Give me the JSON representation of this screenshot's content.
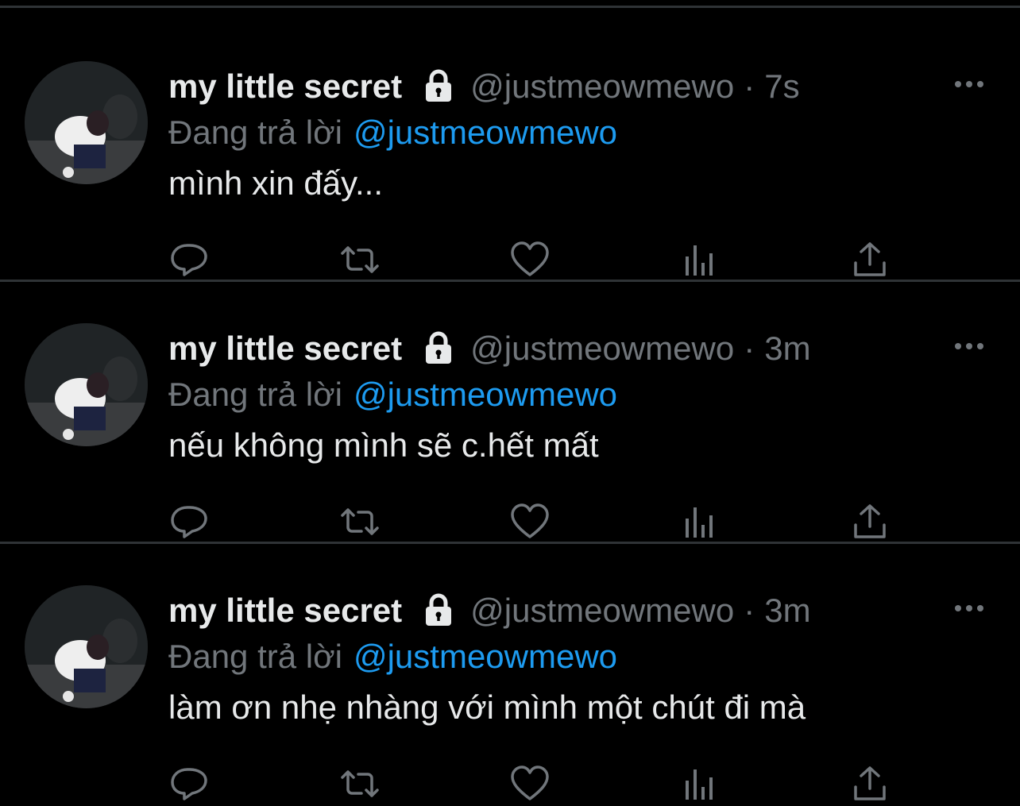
{
  "tweets": [
    {
      "display_name": "my little secret",
      "handle": "@justmeowmewo",
      "separator": "·",
      "time": "7s",
      "reply_prefix": "Đang trả lời",
      "reply_target": "@justmeowmewo",
      "text": "mình xin đấy..."
    },
    {
      "display_name": "my little secret",
      "handle": "@justmeowmewo",
      "separator": "·",
      "time": "3m",
      "reply_prefix": "Đang trả lời",
      "reply_target": "@justmeowmewo",
      "text": "nếu không mình sẽ c.hết mất"
    },
    {
      "display_name": "my little secret",
      "handle": "@justmeowmewo",
      "separator": "·",
      "time": "3m",
      "reply_prefix": "Đang trả lời",
      "reply_target": "@justmeowmewo",
      "text": "làm ơn nhẹ nhàng với mình một chút đi mà"
    }
  ],
  "icons": {
    "lock": "lock-icon",
    "more": "more-icon",
    "reply": "reply-icon",
    "retweet": "retweet-icon",
    "like": "heart-icon",
    "views": "views-icon",
    "share": "share-icon"
  },
  "colors": {
    "background": "#000000",
    "primary_text": "#e7e9ea",
    "secondary_text": "#71767b",
    "link": "#1d9bf0",
    "divider": "#2f3336"
  }
}
